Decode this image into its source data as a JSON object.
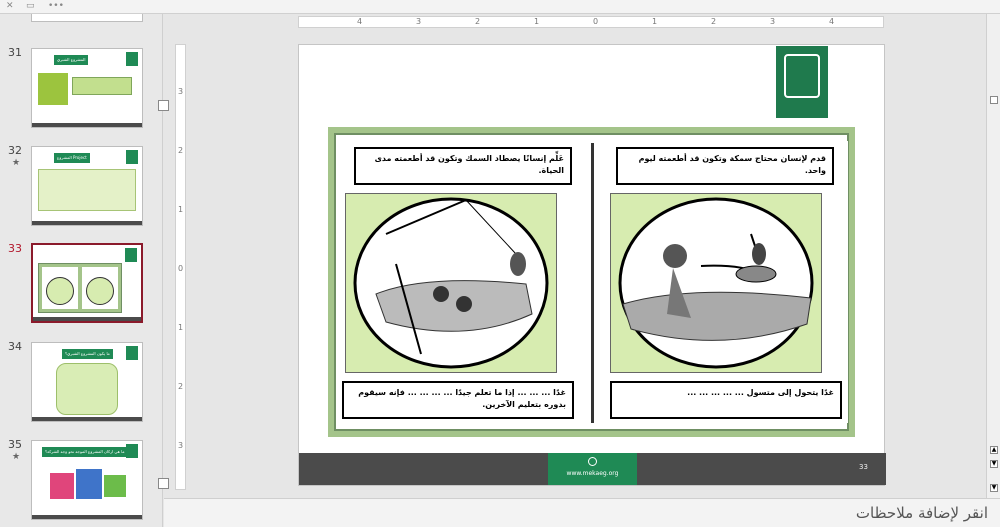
{
  "topbar": {
    "close_icon": "close-icon",
    "layout_icon": "layout-icon",
    "more_icon": "more-icon",
    "more_text": "•••",
    "close_text": "✕"
  },
  "thumbnails": [
    {
      "number": "31",
      "star": false,
      "title": "المشروع الشبري"
    },
    {
      "number": "32",
      "star": true,
      "title": "المشروع Project"
    },
    {
      "number": "33",
      "star": false,
      "title": "",
      "selected": true
    },
    {
      "number": "34",
      "star": false,
      "title": "ما يكون المشروع الشبري؟"
    },
    {
      "number": "35",
      "star": true,
      "title": "ما هي اركان المشروع الموجه نحو وجه الشركة؟"
    }
  ],
  "star_glyph": "★",
  "ruler": {
    "h_ticks": [
      "4",
      "3",
      "2",
      "1",
      "0",
      "1",
      "2",
      "3",
      "4"
    ],
    "v_ticks": [
      "3",
      "2",
      "1",
      "0",
      "1",
      "2",
      "3"
    ]
  },
  "slide": {
    "left_panel": {
      "top_caption": "عَلِّم إنسانًا يصطاد السمك وتكون قد أطعمته مدى الحياة.",
      "bottom_caption": "غدًا ... ... ... إذا ما تعلم جيدًا ... ... ... ... فإنه سيقوم بدوره بتعليم الآخرين."
    },
    "right_panel": {
      "top_caption": "قدم لإنسان محتاج سمكة وتكون قد أطعمته ليوم واحد.",
      "bottom_caption": "غدًا يتحول إلى متسول ... ... ... ... ..."
    },
    "footer": {
      "url": "www.mekaeg.org",
      "page_number": "33"
    }
  },
  "notes": {
    "placeholder": "انقر لإضافة ملاحظات"
  },
  "colors": {
    "accent": "#1f8a55",
    "selected": "#8b1a2b",
    "frame": "#a4c48a",
    "footer": "#4b4b4b"
  }
}
